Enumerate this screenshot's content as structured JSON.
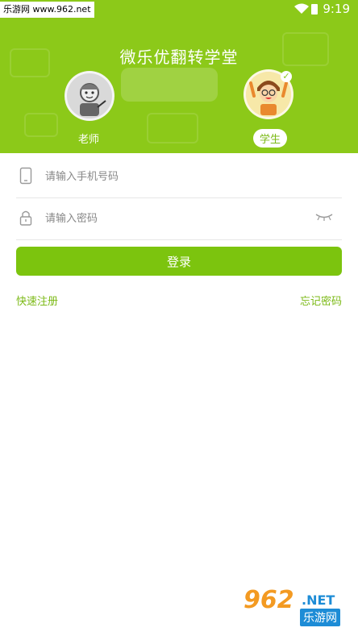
{
  "status_bar": {
    "watermark": "乐游网 www.962.net",
    "time": "9:19"
  },
  "header": {
    "title": "微乐优翻转学堂",
    "roles": [
      {
        "label": "老师"
      },
      {
        "label": "学生"
      }
    ]
  },
  "form": {
    "phone_placeholder": "请输入手机号码",
    "password_placeholder": "请输入密码",
    "login_label": "登录",
    "register_link": "快速注册",
    "forgot_link": "忘记密码"
  },
  "watermark": {
    "number": "962",
    "domain": ".NET",
    "cn": "乐游网"
  },
  "colors": {
    "brand": "#8cc919",
    "button": "#7cc40e",
    "link": "#7bb915"
  }
}
